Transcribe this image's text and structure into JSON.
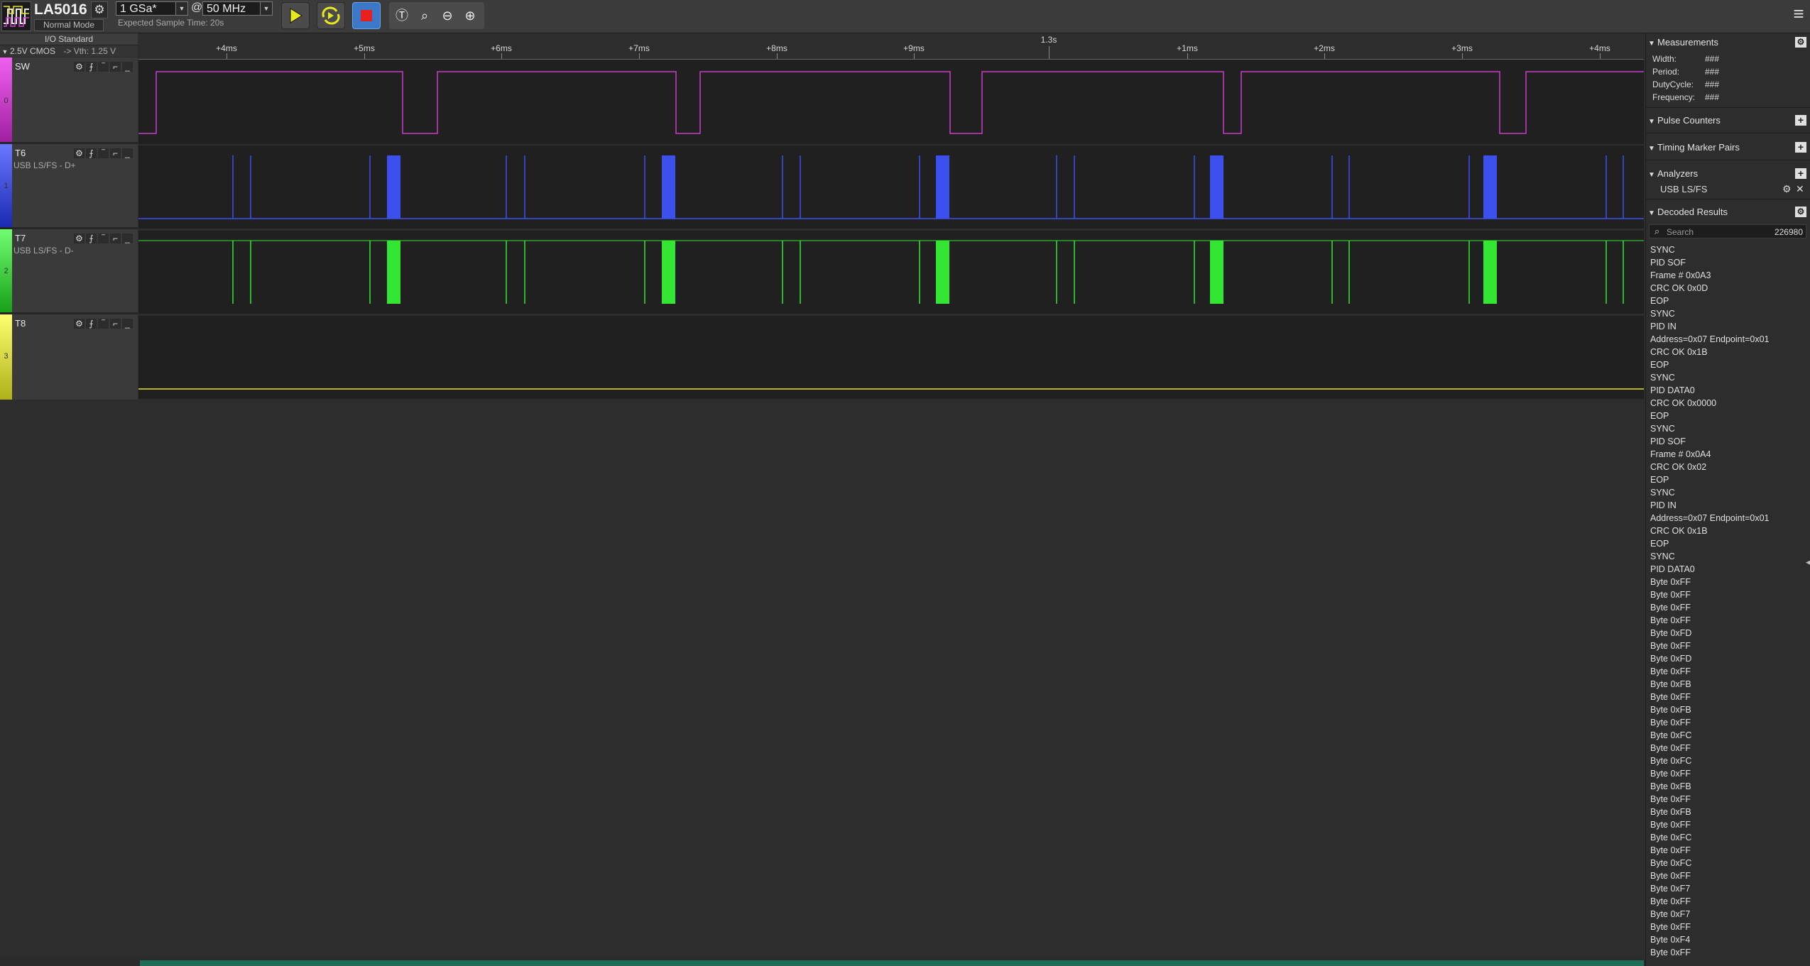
{
  "toolbar": {
    "device_name": "LA5016",
    "device_mode": "Normal Mode",
    "sample_rate": "1 GSa*",
    "at": "@",
    "frequency": "50 MHz",
    "expected_time": "Expected Sample Time: 20s"
  },
  "io": {
    "title": "I/O Standard",
    "standard": "2.5V CMOS",
    "threshold": "-> Vth: 1.25 V"
  },
  "channels": [
    {
      "index": "0",
      "name": "SW",
      "subtitle": "",
      "color": "#c83cc8"
    },
    {
      "index": "1",
      "name": "T6",
      "subtitle": "USB LS/FS - D+",
      "color": "#3c50f0"
    },
    {
      "index": "2",
      "name": "T7",
      "subtitle": "USB LS/FS - D-",
      "color": "#32e632"
    },
    {
      "index": "3",
      "name": "T8",
      "subtitle": "",
      "color": "#e6e632"
    }
  ],
  "ruler": {
    "ticks": [
      "+4ms",
      "+5ms",
      "+6ms",
      "+7ms",
      "+8ms",
      "+9ms",
      "1.3s",
      "+1ms",
      "+2ms",
      "+3ms",
      "+4ms"
    ]
  },
  "measurements": {
    "title": "Measurements",
    "rows": [
      {
        "label": "Width:",
        "value": "###"
      },
      {
        "label": "Period:",
        "value": "###"
      },
      {
        "label": "DutyCycle:",
        "value": "###"
      },
      {
        "label": "Frequency:",
        "value": "###"
      }
    ]
  },
  "pulse_counters": {
    "title": "Pulse Counters"
  },
  "timing_markers": {
    "title": "Timing Marker Pairs"
  },
  "analyzers": {
    "title": "Analyzers",
    "items": [
      "USB LS/FS"
    ]
  },
  "decoded": {
    "title": "Decoded Results",
    "search_placeholder": "Search",
    "count": "226980",
    "items": [
      "SYNC",
      "PID SOF",
      "Frame # 0x0A3",
      "CRC OK 0x0D",
      "EOP",
      "SYNC",
      "PID IN",
      "Address=0x07 Endpoint=0x01",
      "CRC OK 0x1B",
      "EOP",
      "SYNC",
      "PID DATA0",
      "CRC OK 0x0000",
      "EOP",
      "SYNC",
      "PID SOF",
      "Frame # 0x0A4",
      "CRC OK 0x02",
      "EOP",
      "SYNC",
      "PID IN",
      "Address=0x07 Endpoint=0x01",
      "CRC OK 0x1B",
      "EOP",
      "SYNC",
      "PID DATA0",
      "Byte 0xFF",
      "Byte 0xFF",
      "Byte 0xFF",
      "Byte 0xFF",
      "Byte 0xFD",
      "Byte 0xFF",
      "Byte 0xFD",
      "Byte 0xFF",
      "Byte 0xFB",
      "Byte 0xFF",
      "Byte 0xFB",
      "Byte 0xFF",
      "Byte 0xFC",
      "Byte 0xFF",
      "Byte 0xFC",
      "Byte 0xFF",
      "Byte 0xFB",
      "Byte 0xFF",
      "Byte 0xFB",
      "Byte 0xFF",
      "Byte 0xFC",
      "Byte 0xFF",
      "Byte 0xFC",
      "Byte 0xFF",
      "Byte 0xF7",
      "Byte 0xFF",
      "Byte 0xF7",
      "Byte 0xFF",
      "Byte 0xF4",
      "Byte 0xFF"
    ]
  }
}
